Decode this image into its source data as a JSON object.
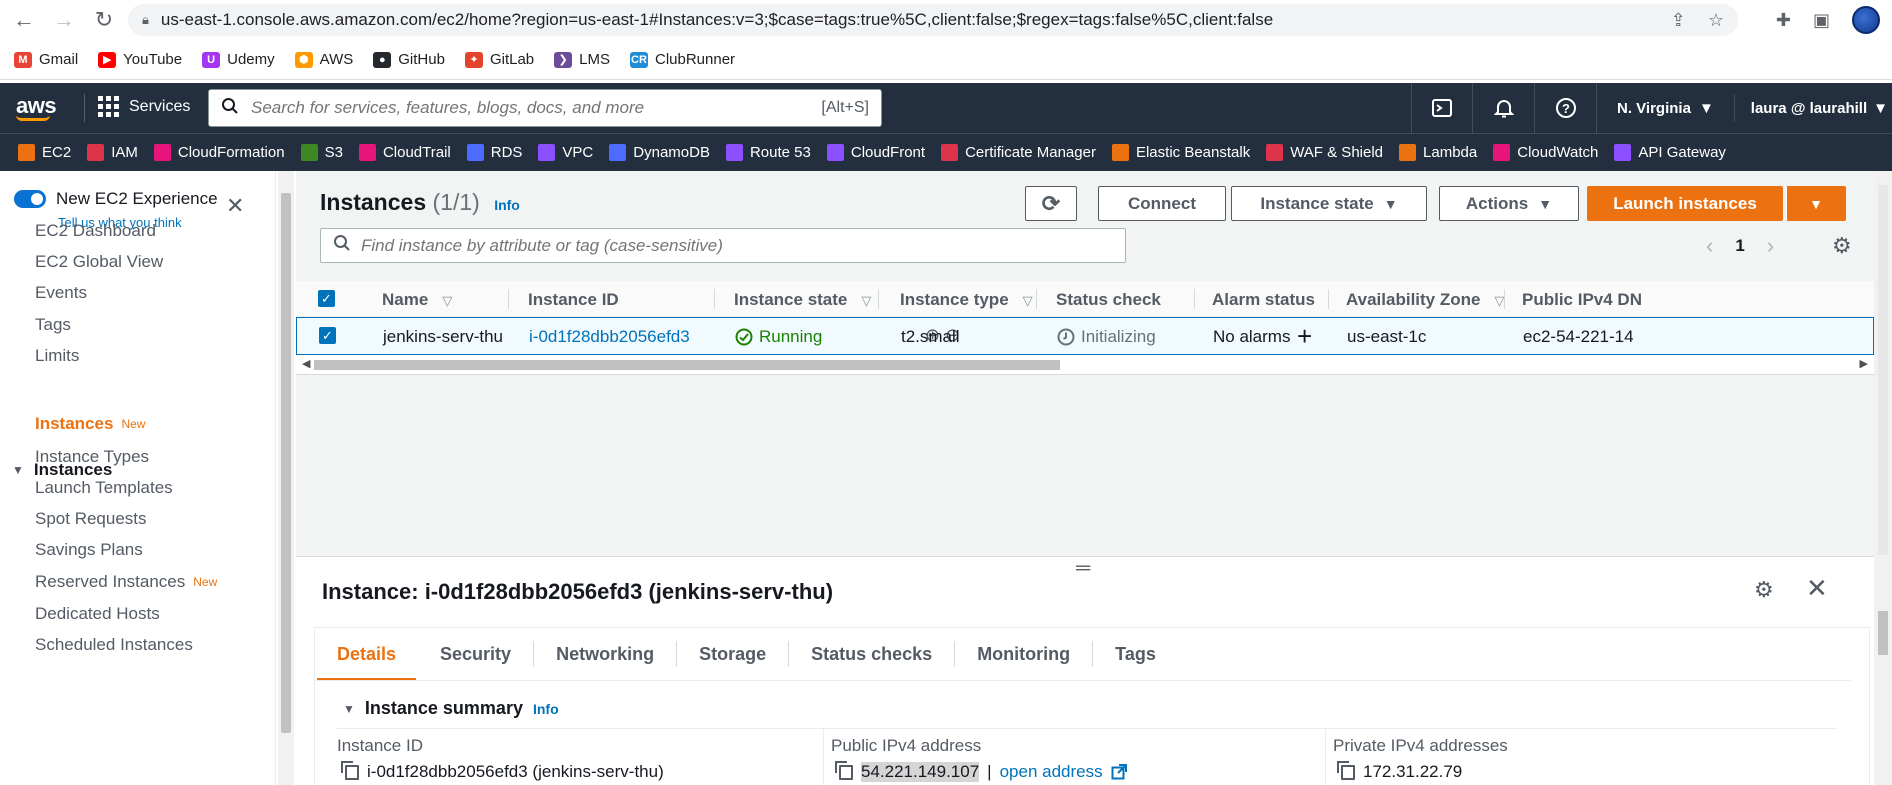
{
  "browser": {
    "url": "us-east-1.console.aws.amazon.com/ec2/home?region=us-east-1#Instances:v=3;$case=tags:true%5C,client:false;$regex=tags:false%5C,client:false",
    "bookmarks": [
      {
        "label": "Gmail",
        "icon": "gmail-icon",
        "color": "#ea4335",
        "glyph": "M"
      },
      {
        "label": "YouTube",
        "icon": "youtube-icon",
        "color": "#ff0000",
        "glyph": "▶"
      },
      {
        "label": "Udemy",
        "icon": "udemy-icon",
        "color": "#a435f0",
        "glyph": "U"
      },
      {
        "label": "AWS",
        "icon": "aws-icon",
        "color": "#ff9900",
        "glyph": "⬢"
      },
      {
        "label": "GitHub",
        "icon": "github-icon",
        "color": "#24292f",
        "glyph": "●"
      },
      {
        "label": "GitLab",
        "icon": "gitlab-icon",
        "color": "#e24329",
        "glyph": "✦"
      },
      {
        "label": "LMS",
        "icon": "lms-icon",
        "color": "#6b4c9a",
        "glyph": "❯"
      },
      {
        "label": "ClubRunner",
        "icon": "clubrunner-icon",
        "color": "#1f8dd6",
        "glyph": "CR"
      }
    ]
  },
  "aws": {
    "logo": "aws",
    "services_label": "Services",
    "search_placeholder": "Search for services, features, blogs, docs, and more",
    "search_shortcut": "[Alt+S]",
    "region": "N. Virginia",
    "user": "laura @ laurahill",
    "favorites": [
      {
        "label": "EC2",
        "color": "#ec7211"
      },
      {
        "label": "IAM",
        "color": "#dd344c"
      },
      {
        "label": "CloudFormation",
        "color": "#e7157b"
      },
      {
        "label": "S3",
        "color": "#3f8624"
      },
      {
        "label": "CloudTrail",
        "color": "#e7157b"
      },
      {
        "label": "RDS",
        "color": "#4d6bfe"
      },
      {
        "label": "VPC",
        "color": "#8c4fff"
      },
      {
        "label": "DynamoDB",
        "color": "#4d6bfe"
      },
      {
        "label": "Route 53",
        "color": "#8c4fff"
      },
      {
        "label": "CloudFront",
        "color": "#8c4fff"
      },
      {
        "label": "Certificate Manager",
        "color": "#dd344c"
      },
      {
        "label": "Elastic Beanstalk",
        "color": "#ec7211"
      },
      {
        "label": "WAF & Shield",
        "color": "#dd344c"
      },
      {
        "label": "Lambda",
        "color": "#ec7211"
      },
      {
        "label": "CloudWatch",
        "color": "#e7157b"
      },
      {
        "label": "API Gateway",
        "color": "#8c4fff"
      }
    ]
  },
  "leftnav": {
    "new_experience": "New EC2 Experience",
    "tell_us": "Tell us what you think",
    "items_top": [
      "EC2 Dashboard",
      "EC2 Global View",
      "Events",
      "Tags",
      "Limits"
    ],
    "section": "Instances",
    "items_instances": [
      {
        "label": "Instances",
        "badge": "New",
        "active": true
      },
      {
        "label": "Instance Types",
        "badge": ""
      },
      {
        "label": "Launch Templates",
        "badge": ""
      },
      {
        "label": "Spot Requests",
        "badge": ""
      },
      {
        "label": "Savings Plans",
        "badge": ""
      },
      {
        "label": "Reserved Instances",
        "badge": "New"
      },
      {
        "label": "Dedicated Hosts",
        "badge": ""
      },
      {
        "label": "Scheduled Instances",
        "badge": ""
      }
    ]
  },
  "instances": {
    "title": "Instances",
    "count": "(1/1)",
    "info": "Info",
    "connect": "Connect",
    "instance_state": "Instance state",
    "actions": "Actions",
    "launch": "Launch instances",
    "filter_placeholder": "Find instance by attribute or tag (case-sensitive)",
    "page": "1",
    "columns": [
      "Name",
      "Instance ID",
      "Instance state",
      "Instance type",
      "Status check",
      "Alarm status",
      "Availability Zone",
      "Public IPv4 DN"
    ],
    "row": {
      "name": "jenkins-serv-thu",
      "id": "i-0d1f28dbb2056efd3",
      "state": "Running",
      "type": "t2.small",
      "status": "Initializing",
      "alarm": "No alarms",
      "az": "us-east-1c",
      "dns": "ec2-54-221-14"
    }
  },
  "detail": {
    "title": "Instance: i-0d1f28dbb2056efd3 (jenkins-serv-thu)",
    "tabs": [
      "Details",
      "Security",
      "Networking",
      "Storage",
      "Status checks",
      "Monitoring",
      "Tags"
    ],
    "summary": "Instance summary",
    "info": "Info",
    "instance_id_label": "Instance ID",
    "instance_id_value": "i-0d1f28dbb2056efd3 (jenkins-serv-thu)",
    "public_ip_label": "Public IPv4 address",
    "public_ip_value": "54.221.149.107",
    "open_address": "open address",
    "private_ip_label": "Private IPv4 addresses",
    "private_ip_value": "172.31.22.79"
  },
  "colors": {
    "accent": "#ec7211",
    "link": "#0073bb",
    "header": "#232f3e",
    "running": "#1d8102"
  }
}
